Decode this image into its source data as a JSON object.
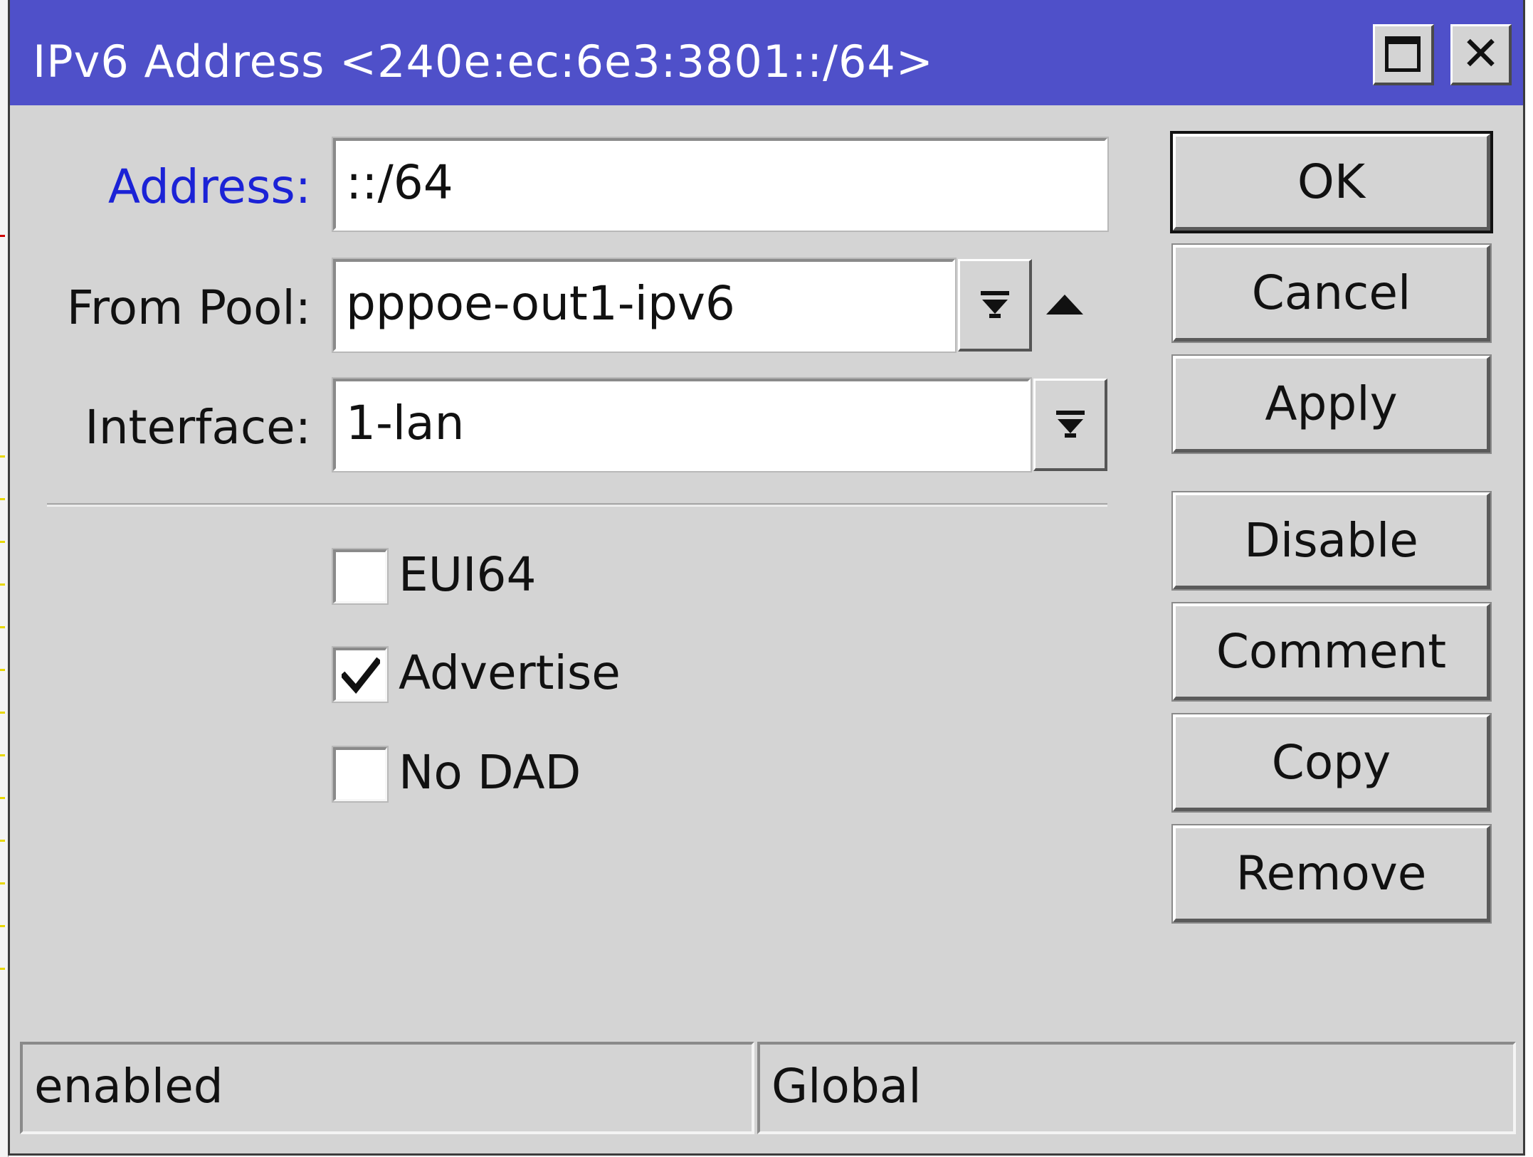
{
  "window": {
    "title": "IPv6 Address <240e:ec:6e3:3801::/64>",
    "maximize_icon": "maximize-icon",
    "close_icon": "close-icon",
    "close_glyph": "✕"
  },
  "form": {
    "address": {
      "label": "Address:",
      "value": "::/64",
      "label_color": "#1b22d6"
    },
    "from_pool": {
      "label": "From Pool:",
      "value": "pppoe-out1-ipv6",
      "dropdown_icon": "dropdown-arrow-icon",
      "collapse_icon": "up-arrow-icon"
    },
    "interface": {
      "label": "Interface:",
      "value": "1-lan",
      "dropdown_icon": "dropdown-arrow-icon"
    }
  },
  "options": {
    "eui64": {
      "label": "EUI64",
      "checked": false
    },
    "advertise": {
      "label": "Advertise",
      "checked": true
    },
    "no_dad": {
      "label": "No DAD",
      "checked": false
    }
  },
  "buttons": {
    "ok": "OK",
    "cancel": "Cancel",
    "apply": "Apply",
    "disable": "Disable",
    "comment": "Comment",
    "copy": "Copy",
    "remove": "Remove"
  },
  "status": {
    "state": "enabled",
    "scope": "Global"
  },
  "colors": {
    "titlebar": "#4f50c9",
    "window_bg": "#d4d4d4",
    "field_bg": "#ffffff"
  }
}
